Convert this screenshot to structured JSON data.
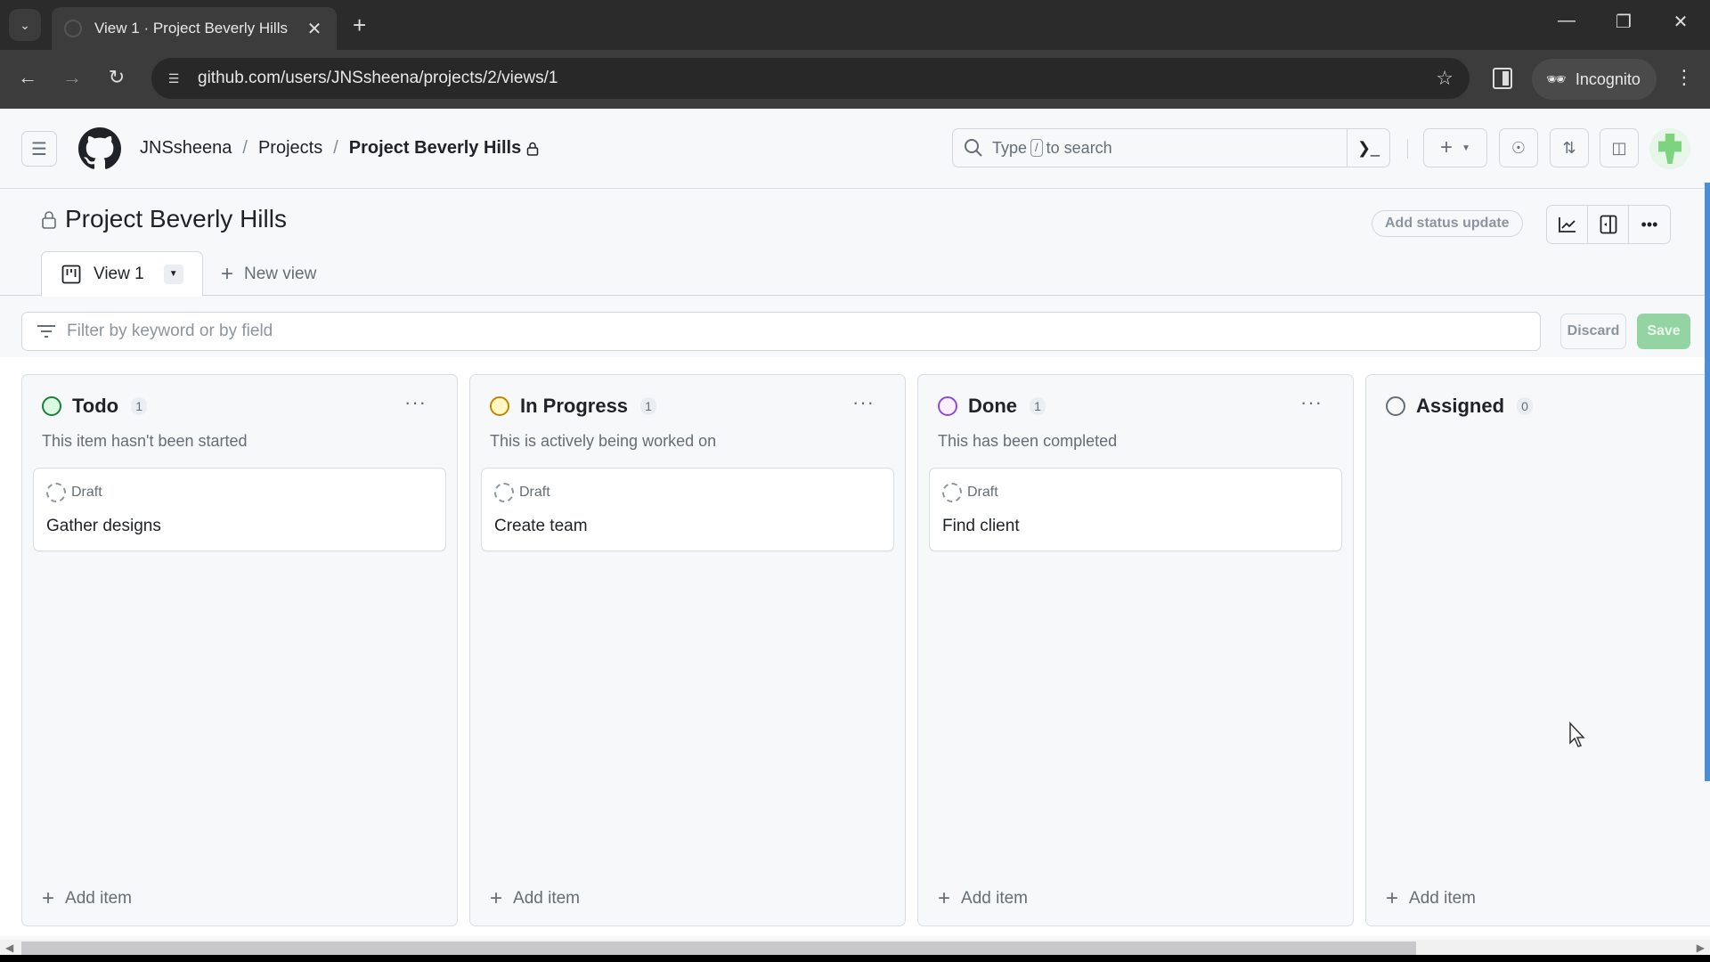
{
  "browser": {
    "tab_title": "View 1 · Project Beverly Hills",
    "new_tab": "+",
    "url": "github.com/users/JNSsheena/projects/2/views/1",
    "incognito_label": "Incognito"
  },
  "header": {
    "breadcrumb": [
      "JNSsheena",
      "Projects",
      "Project Beverly Hills"
    ],
    "search_prefix": "Type",
    "search_key": "/",
    "search_suffix": "to search"
  },
  "project": {
    "title": "Project Beverly Hills",
    "add_status_label": "Add status update"
  },
  "views": {
    "tabs": [
      {
        "label": "View 1"
      }
    ],
    "new_view_label": "New view"
  },
  "filter": {
    "placeholder": "Filter by keyword or by field",
    "discard_label": "Discard",
    "save_label": "Save"
  },
  "board": {
    "add_item_label": "Add item",
    "columns": [
      {
        "name": "Todo",
        "count": "1",
        "color": "#1a7f37",
        "fill": "#dafbe1",
        "description": "This item hasn't been started",
        "cards": [
          {
            "type": "Draft",
            "title": "Gather designs"
          }
        ]
      },
      {
        "name": "In Progress",
        "count": "1",
        "color": "#bf8700",
        "fill": "#fff8c5",
        "description": "This is actively being worked on",
        "cards": [
          {
            "type": "Draft",
            "title": "Create team"
          }
        ]
      },
      {
        "name": "Done",
        "count": "1",
        "color": "#8250df",
        "fill": "#fbefff",
        "description": "This has been completed",
        "cards": [
          {
            "type": "Draft",
            "title": "Find client"
          }
        ]
      },
      {
        "name": "Assigned",
        "count": "0",
        "color": "#656d76",
        "fill": "#f6f8fa",
        "description": "",
        "cards": []
      }
    ]
  }
}
